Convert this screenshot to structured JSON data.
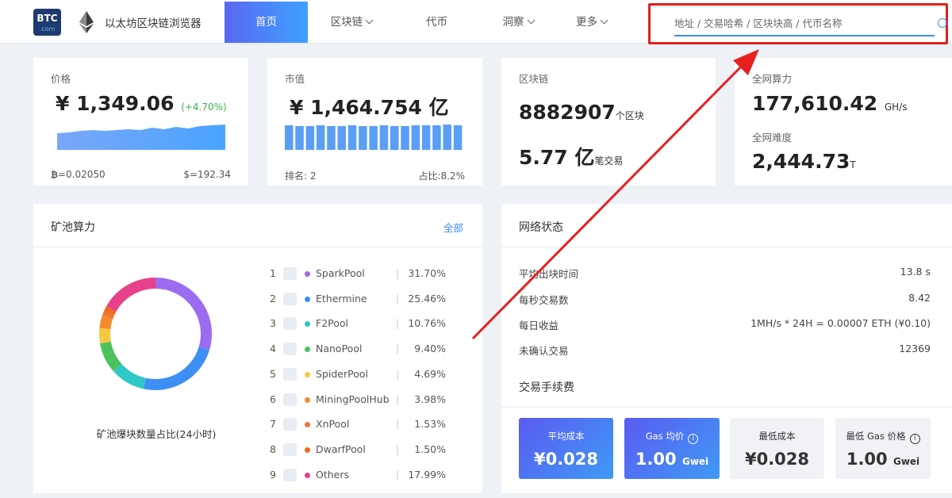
{
  "header": {
    "logo_text": "BTC",
    "logo_sub": ".com",
    "site_title": "以太坊区块链浏览器",
    "nav": [
      {
        "label": "首页",
        "active": true,
        "dropdown": false
      },
      {
        "label": "区块链",
        "active": false,
        "dropdown": true
      },
      {
        "label": "代币",
        "active": false,
        "dropdown": false
      },
      {
        "label": "洞察",
        "active": false,
        "dropdown": true
      },
      {
        "label": "更多",
        "active": false,
        "dropdown": true
      }
    ],
    "search": {
      "placeholder": "地址 / 交易哈希 / 区块块高 / 代币名称",
      "value": ""
    }
  },
  "stats": {
    "price": {
      "label": "价格",
      "value": "¥ 1,349.06",
      "change": "(+4.70%)",
      "btc": "=0.02050",
      "usd": "$=192.34"
    },
    "market_cap": {
      "label": "市值",
      "value": "¥ 1,464.754",
      "unit": "亿",
      "rank": "排名: 2",
      "share": "占比:8.2%"
    },
    "blockchain": {
      "label": "区块链",
      "blocks": "8882907",
      "blocks_unit": "个区块",
      "txs": "5.77",
      "txs_unit": "亿",
      "txs_suffix": "笔交易"
    },
    "network": {
      "hashrate_label": "全网算力",
      "hashrate": "177,610.42",
      "hashrate_unit": "GH/s",
      "difficulty_label": "全网难度",
      "difficulty": "2,444.73",
      "difficulty_unit": "T"
    }
  },
  "pools": {
    "title": "矿池算力",
    "all_link": "全部",
    "caption": "矿池爆块数量占比(24小时)",
    "items": [
      {
        "rank": "1",
        "name": "SparkPool",
        "pct": "31.70%",
        "value": 31.7,
        "color": "#9b6cf0"
      },
      {
        "rank": "2",
        "name": "Ethermine",
        "pct": "25.46%",
        "value": 25.46,
        "color": "#3d8ff5"
      },
      {
        "rank": "3",
        "name": "F2Pool",
        "pct": "10.76%",
        "value": 10.76,
        "color": "#2ec8c8"
      },
      {
        "rank": "4",
        "name": "NanoPool",
        "pct": "9.40%",
        "value": 9.4,
        "color": "#4dc25c"
      },
      {
        "rank": "5",
        "name": "SpiderPool",
        "pct": "4.69%",
        "value": 4.69,
        "color": "#f5c842"
      },
      {
        "rank": "6",
        "name": "MiningPoolHub",
        "pct": "3.98%",
        "value": 3.98,
        "color": "#f58a2c"
      },
      {
        "rank": "7",
        "name": "XnPool",
        "pct": "1.53%",
        "value": 1.53,
        "color": "#f0743a"
      },
      {
        "rank": "8",
        "name": "DwarfPool",
        "pct": "1.50%",
        "value": 1.5,
        "color": "#f06a1c"
      },
      {
        "rank": "9",
        "name": "Others",
        "pct": "17.99%",
        "value": 17.99,
        "color": "#e8408a"
      }
    ]
  },
  "network_status": {
    "title": "网络状态",
    "rows": [
      {
        "key": "平均出块时间",
        "value": "13.8 s"
      },
      {
        "key": "每秒交易数",
        "value": "8.42"
      },
      {
        "key": "每日收益",
        "value": "1MH/s * 24H = 0.00007 ETH (¥0.10)"
      },
      {
        "key": "未确认交易",
        "value": "12369"
      }
    ],
    "fee_title": "交易手续费",
    "fees": [
      {
        "label": "平均成本",
        "value": "¥0.028",
        "unit": ""
      },
      {
        "label": "Gas 均价",
        "value": "1.00",
        "unit": "Gwei"
      },
      {
        "label": "最低成本",
        "value": "¥0.028",
        "unit": ""
      },
      {
        "label": "最低 Gas 价格",
        "value": "1.00",
        "unit": "Gwei"
      }
    ]
  },
  "colors": {
    "accent": "#3b8cff",
    "nav_active_from": "#5968f0",
    "nav_active_to": "#3fa0ff",
    "highlight": "#e02020",
    "positive": "#3bb34a"
  }
}
